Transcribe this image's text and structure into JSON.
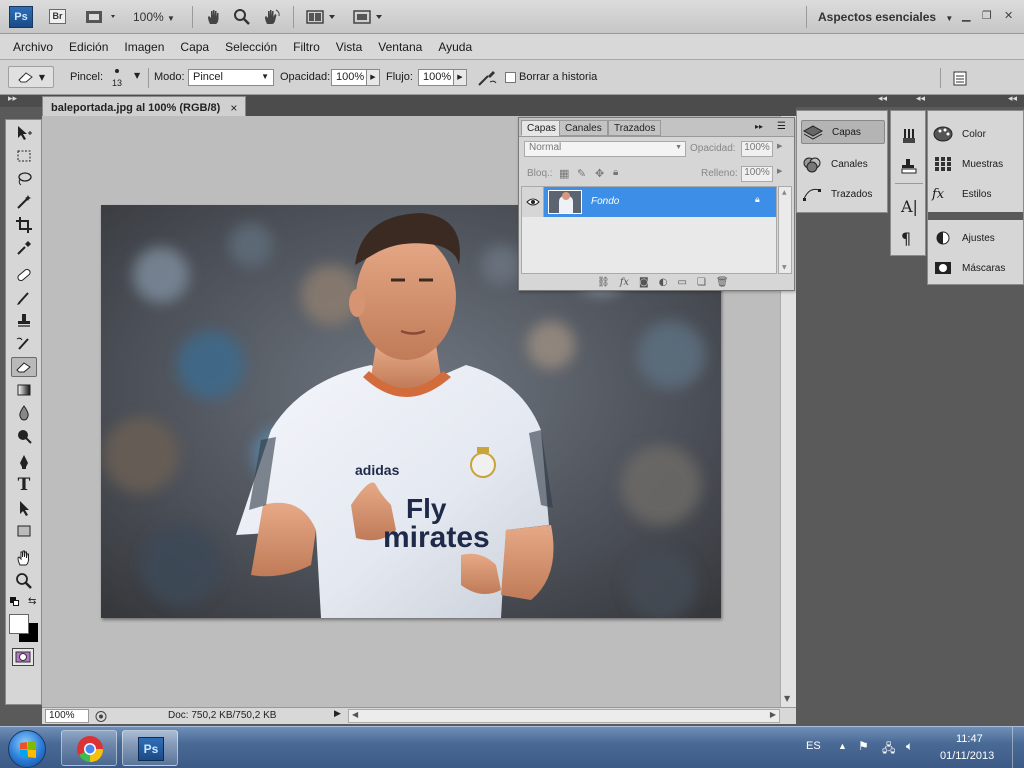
{
  "app": {
    "logo": "Ps",
    "bridge": "Br",
    "zoom": "100%",
    "workspace": "Aspectos esenciales"
  },
  "menu": [
    "Archivo",
    "Edición",
    "Imagen",
    "Capa",
    "Selección",
    "Filtro",
    "Vista",
    "Ventana",
    "Ayuda"
  ],
  "options": {
    "brush_label": "Pincel:",
    "brush_size": "13",
    "mode_label": "Modo:",
    "mode_value": "Pincel",
    "opacity_label": "Opacidad:",
    "opacity_value": "100%",
    "flow_label": "Flujo:",
    "flow_value": "100%",
    "erase_history_label": "Borrar a historia"
  },
  "document": {
    "tab_title": "baleportada.jpg al 100% (RGB/8)",
    "close": "×",
    "status_zoom": "100%",
    "status_doc": "Doc: 750,2 KB/750,2 KB"
  },
  "photo": {
    "jersey_brand": "adidas",
    "sponsor_line1": "Fly",
    "sponsor_line2": "mirates"
  },
  "layers_panel": {
    "tabs": [
      "Capas",
      "Canales",
      "Trazados"
    ],
    "blend_mode": "Normal",
    "opacity_label": "Opacidad:",
    "opacity_value": "100%",
    "lock_label": "Bloq.:",
    "fill_label": "Relleno:",
    "fill_value": "100%",
    "layer_name": "Fondo"
  },
  "dock": {
    "group1": [
      "Capas",
      "Canales",
      "Trazados"
    ],
    "group3": [
      "Color",
      "Muestras",
      "Estilos",
      "Ajustes",
      "Máscaras"
    ]
  },
  "taskbar": {
    "language": "ES",
    "time": "11:47",
    "date": "01/11/2013"
  },
  "colors": {
    "accent_selection": "#3d8ee6",
    "taskbar": "#4a6a96"
  }
}
